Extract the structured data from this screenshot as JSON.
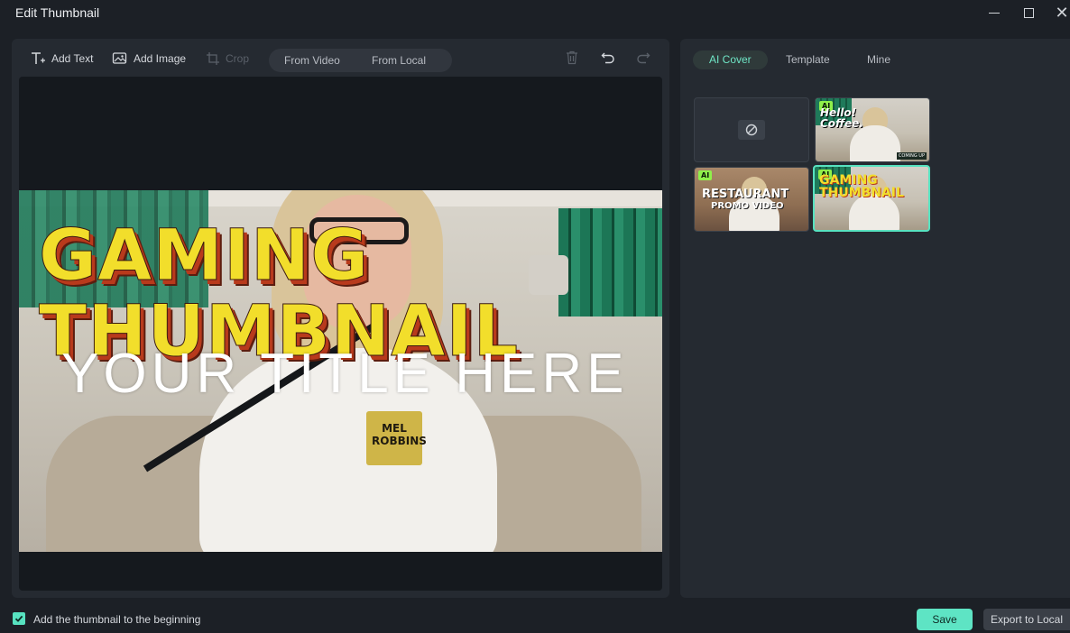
{
  "window": {
    "title": "Edit Thumbnail"
  },
  "toolbar": {
    "add_text": "Add Text",
    "add_image": "Add Image",
    "crop": "Crop",
    "source_options": [
      "From Video",
      "From Local"
    ]
  },
  "canvas": {
    "overlay_line1": "GAMING",
    "overlay_line2": "THUMBNAIL",
    "title_placeholder": "YOUR TITLE HERE",
    "tag_text": "MEL ROBBINS"
  },
  "side_panel": {
    "tabs": [
      {
        "label": "AI Cover",
        "active": true
      },
      {
        "label": "Template",
        "active": false
      },
      {
        "label": "Mine",
        "active": false
      }
    ],
    "thumbnails": [
      {
        "name": "none",
        "badge": "",
        "label": ""
      },
      {
        "name": "hello-coffee",
        "badge": "AI",
        "label": "Hello! Coffee.",
        "footer": "COMING UP"
      },
      {
        "name": "restaurant-promo",
        "badge": "AI",
        "label": "RESTAURANT",
        "sublabel": "PROMO VIDEO"
      },
      {
        "name": "gaming-thumbnail",
        "badge": "AI",
        "label": "GAMING THUMBNAIL",
        "selected": true
      }
    ]
  },
  "footer": {
    "checkbox_label": "Add the thumbnail to the beginning",
    "checkbox_checked": true,
    "save": "Save",
    "export": "Export to Local"
  },
  "colors": {
    "accent": "#57e2c0",
    "headline_yellow": "#f2de2b",
    "panel_bg": "#252a31"
  }
}
